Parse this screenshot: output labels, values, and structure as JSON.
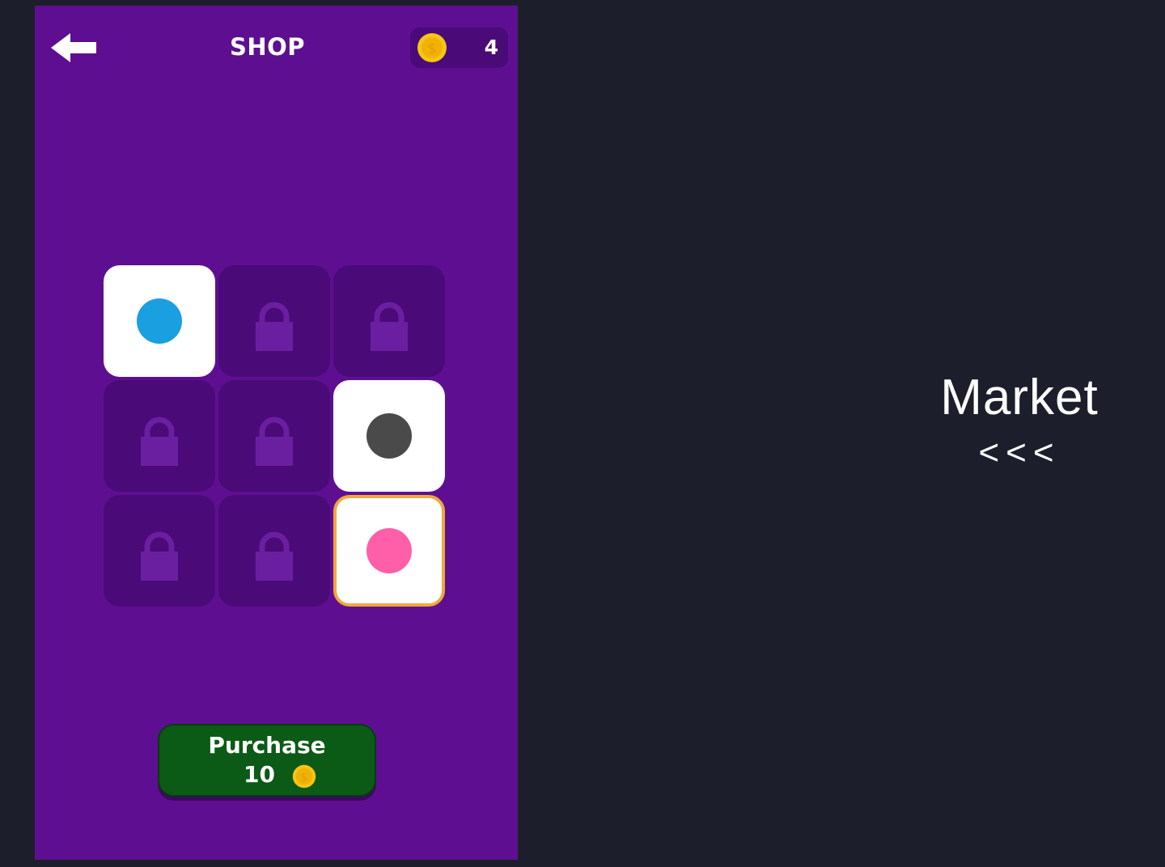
{
  "shop": {
    "title": "SHOP",
    "coins": "4",
    "back_icon": "arrow-left-icon",
    "coin_icon": "coin-icon"
  },
  "colors": {
    "background": "#1c1f2b",
    "panel": "#5e0f91",
    "locked_tile": "#4a0a78",
    "selected_border": "#f0a83c",
    "purchase_button": "#0b5a16",
    "coin": "#f5c518"
  },
  "tiles": [
    {
      "state": "unlocked",
      "color": "#1a9fe0"
    },
    {
      "state": "locked"
    },
    {
      "state": "locked"
    },
    {
      "state": "locked"
    },
    {
      "state": "locked"
    },
    {
      "state": "unlocked",
      "color": "#4a4a4a"
    },
    {
      "state": "locked"
    },
    {
      "state": "locked"
    },
    {
      "state": "selected",
      "color": "#ff5fa8"
    }
  ],
  "purchase": {
    "label": "Purchase",
    "price": "10"
  },
  "caption": {
    "title": "Market",
    "arrows": "<<<"
  }
}
